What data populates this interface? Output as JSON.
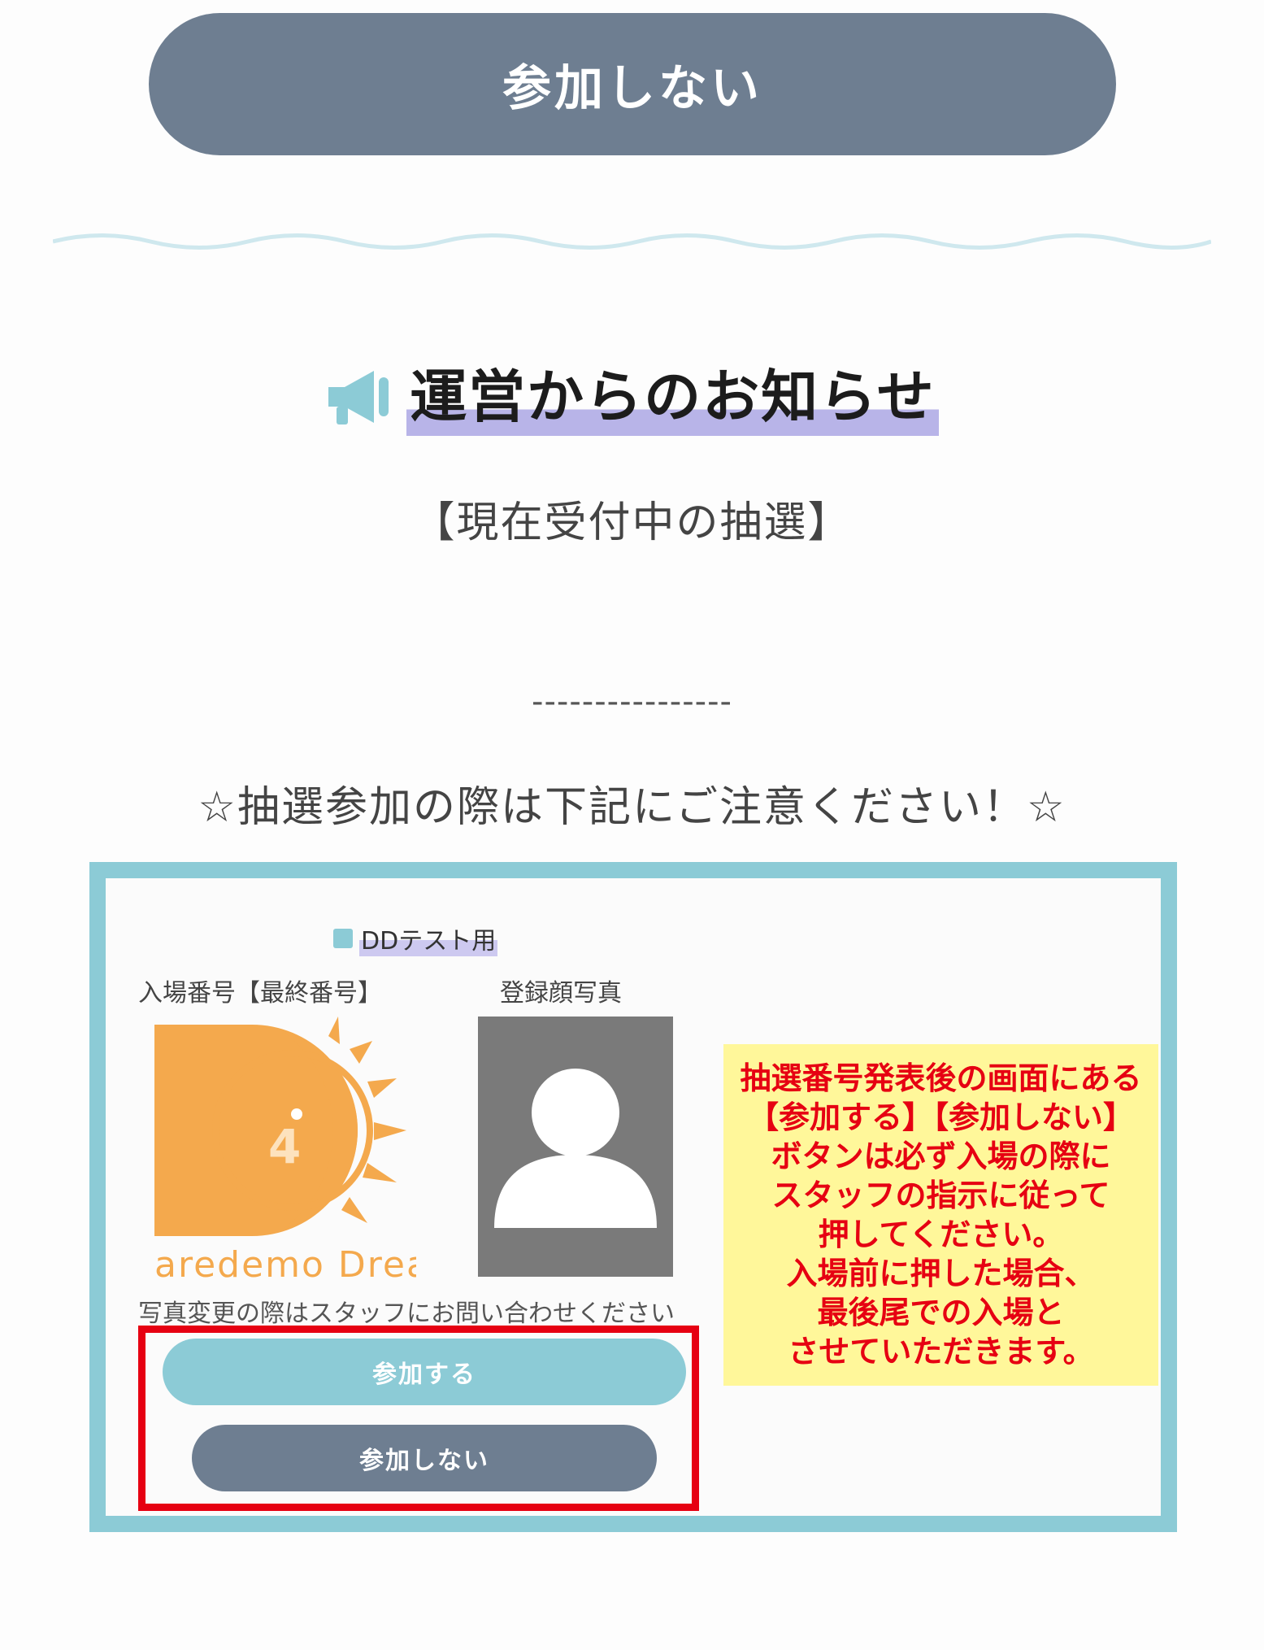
{
  "top_button": {
    "label": "参加しない"
  },
  "notice": {
    "title": "運営からのお知らせ",
    "subtitle": "【現在受付中の抽選】",
    "separator": "----------------",
    "caution": "☆抽選参加の際は下記にご注意ください！☆"
  },
  "screenshot": {
    "group_label": "DDテスト用",
    "entry_number_label": "入場番号【最終番号】",
    "photo_label": "登録顔写真",
    "logo_number": "4",
    "logo_text": "aredemo Drean",
    "photo_note": "写真変更の際はスタッフにお問い合わせください",
    "join_button": "参加する",
    "decline_button": "参加しない",
    "warning_lines": [
      "抽選番号発表後の画面にある",
      "【参加する】【参加しない】",
      "ボタンは必ず入場の際に",
      "スタッフの指示に従って",
      "押してください。",
      "入場前に押した場合、",
      "最後尾での入場と",
      "させていただきます。"
    ]
  },
  "colors": {
    "gray_button": "#6e7e91",
    "teal": "#8ccbd6",
    "highlight": "#b8b4e8",
    "warning_bg": "#fff79a",
    "warning_text": "#e60012",
    "logo_orange": "#f4a94d"
  }
}
